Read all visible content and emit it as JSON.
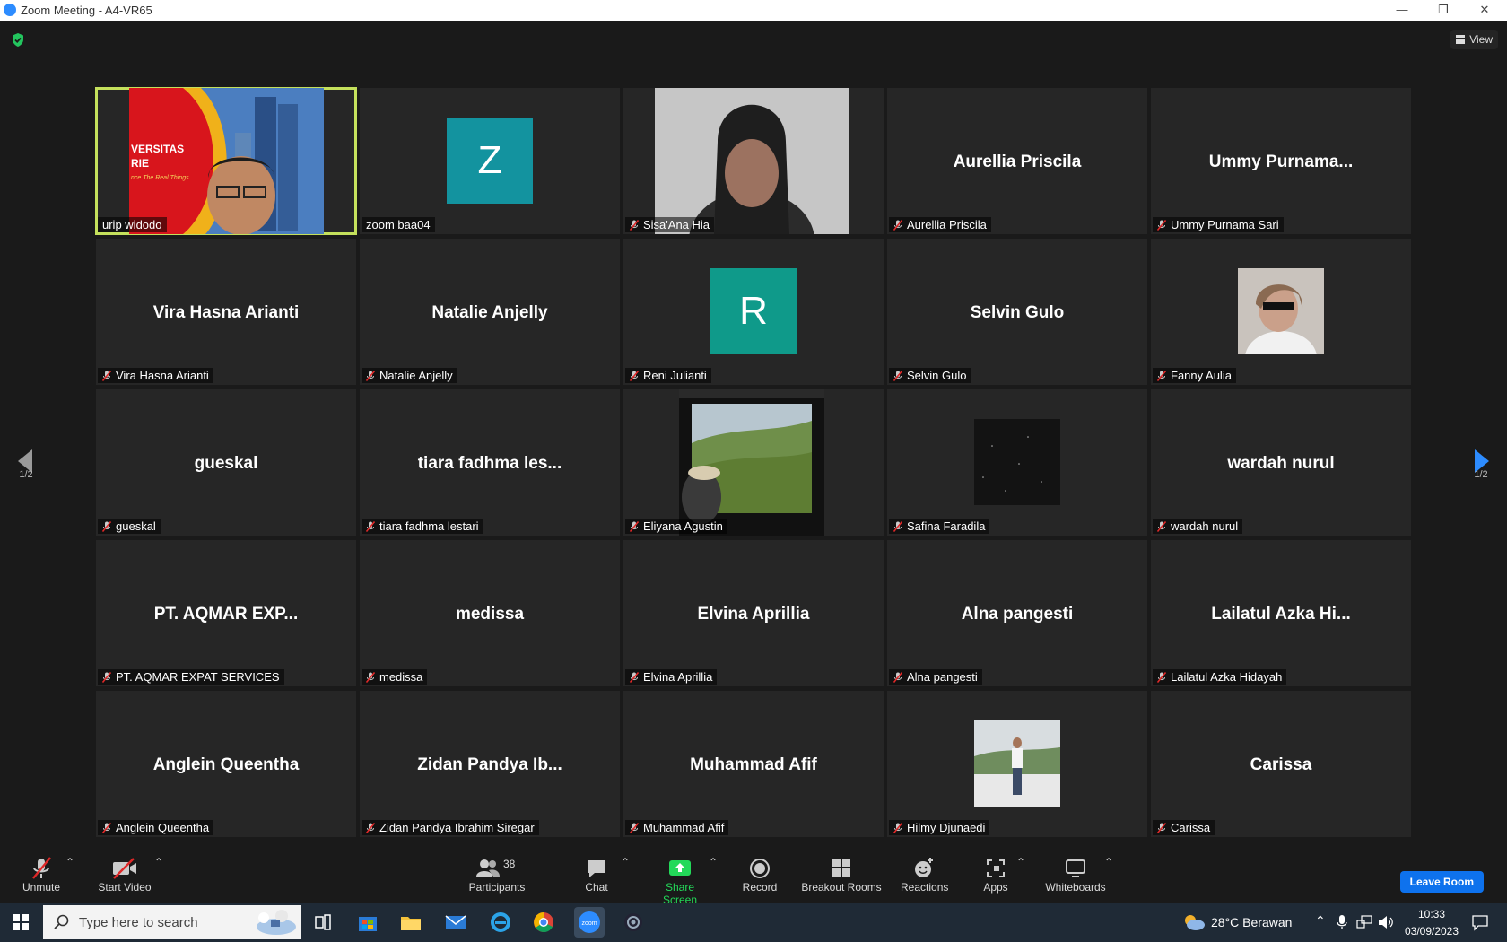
{
  "window": {
    "title": "Zoom Meeting - A4-VR65",
    "controls": [
      "—",
      "❐",
      "✕"
    ]
  },
  "top": {
    "view_label": "View"
  },
  "pager": {
    "left": "1/2",
    "right": "1/2"
  },
  "tiles": [
    {
      "big": "",
      "tag": "urip widodo",
      "muted": false,
      "kind": "video-presenter"
    },
    {
      "big": "",
      "tag": "zoom baa04",
      "muted": false,
      "kind": "avatar",
      "letter": "Z",
      "color": "#13939f"
    },
    {
      "big": "",
      "tag": "Sisa'Ana Hia",
      "muted": true,
      "kind": "video-face"
    },
    {
      "big": "Aurellia Priscila",
      "tag": "Aurellia Priscila",
      "muted": true,
      "kind": "name"
    },
    {
      "big": "Ummy  Purnama...",
      "tag": "Ummy Purnama Sari",
      "muted": true,
      "kind": "name"
    },
    {
      "big": "Vira Hasna Arianti",
      "tag": "Vira Hasna Arianti",
      "muted": true,
      "kind": "name"
    },
    {
      "big": "Natalie Anjelly",
      "tag": "Natalie Anjelly",
      "muted": true,
      "kind": "name"
    },
    {
      "big": "",
      "tag": "Reni Julianti",
      "muted": true,
      "kind": "avatar",
      "letter": "R",
      "color": "#0f9a8a"
    },
    {
      "big": "Selvin Gulo",
      "tag": "Selvin Gulo",
      "muted": true,
      "kind": "name"
    },
    {
      "big": "",
      "tag": "Fanny Aulia",
      "muted": true,
      "kind": "photo-person"
    },
    {
      "big": "gueskal",
      "tag": "gueskal",
      "muted": true,
      "kind": "name"
    },
    {
      "big": "tiara fadhma les...",
      "tag": "tiara fadhma lestari",
      "muted": true,
      "kind": "name"
    },
    {
      "big": "",
      "tag": "Eliyana Agustin",
      "muted": true,
      "kind": "video-window"
    },
    {
      "big": "",
      "tag": "Safina Faradila",
      "muted": true,
      "kind": "photo-dark"
    },
    {
      "big": "wardah nurul",
      "tag": "wardah nurul",
      "muted": true,
      "kind": "name"
    },
    {
      "big": "PT. AQMAR EXP...",
      "tag": "PT. AQMAR EXPAT SERVICES",
      "muted": true,
      "kind": "name"
    },
    {
      "big": "medissa",
      "tag": "medissa",
      "muted": true,
      "kind": "name"
    },
    {
      "big": "Elvina Aprillia",
      "tag": "Elvina Aprillia",
      "muted": true,
      "kind": "name"
    },
    {
      "big": "Alna pangesti",
      "tag": "Alna pangesti",
      "muted": true,
      "kind": "name"
    },
    {
      "big": "Lailatul  Azka  Hi...",
      "tag": "Lailatul Azka Hidayah",
      "muted": true,
      "kind": "name"
    },
    {
      "big": "Anglein Queentha",
      "tag": "Anglein Queentha",
      "muted": true,
      "kind": "name"
    },
    {
      "big": "Zidan  Pandya  Ib...",
      "tag": "Zidan Pandya Ibrahim Siregar",
      "muted": true,
      "kind": "name"
    },
    {
      "big": "Muhammad Afif",
      "tag": "Muhammad Afif",
      "muted": true,
      "kind": "name"
    },
    {
      "big": "",
      "tag": "Hilmy Djunaedi",
      "muted": true,
      "kind": "photo-landscape"
    },
    {
      "big": "Carissa",
      "tag": "Carissa",
      "muted": true,
      "kind": "name"
    }
  ],
  "presenter_slide": {
    "line1": "VERSITAS",
    "line2": "RIE",
    "line3": "nce The Real Things"
  },
  "toolbar": {
    "unmute": "Unmute",
    "start_video": "Start Video",
    "participants": "Participants",
    "participants_count": "38",
    "chat": "Chat",
    "share": "Share Screen",
    "record": "Record",
    "breakout": "Breakout Rooms",
    "reactions": "Reactions",
    "apps": "Apps",
    "whiteboards": "Whiteboards",
    "leave": "Leave Room",
    "share_color": "#23d959",
    "leave_color": "#0e72ed"
  },
  "taskbar": {
    "search_placeholder": "Type here to search",
    "weather": "28°C  Berawan",
    "time": "10:33",
    "date": "03/09/2023"
  }
}
